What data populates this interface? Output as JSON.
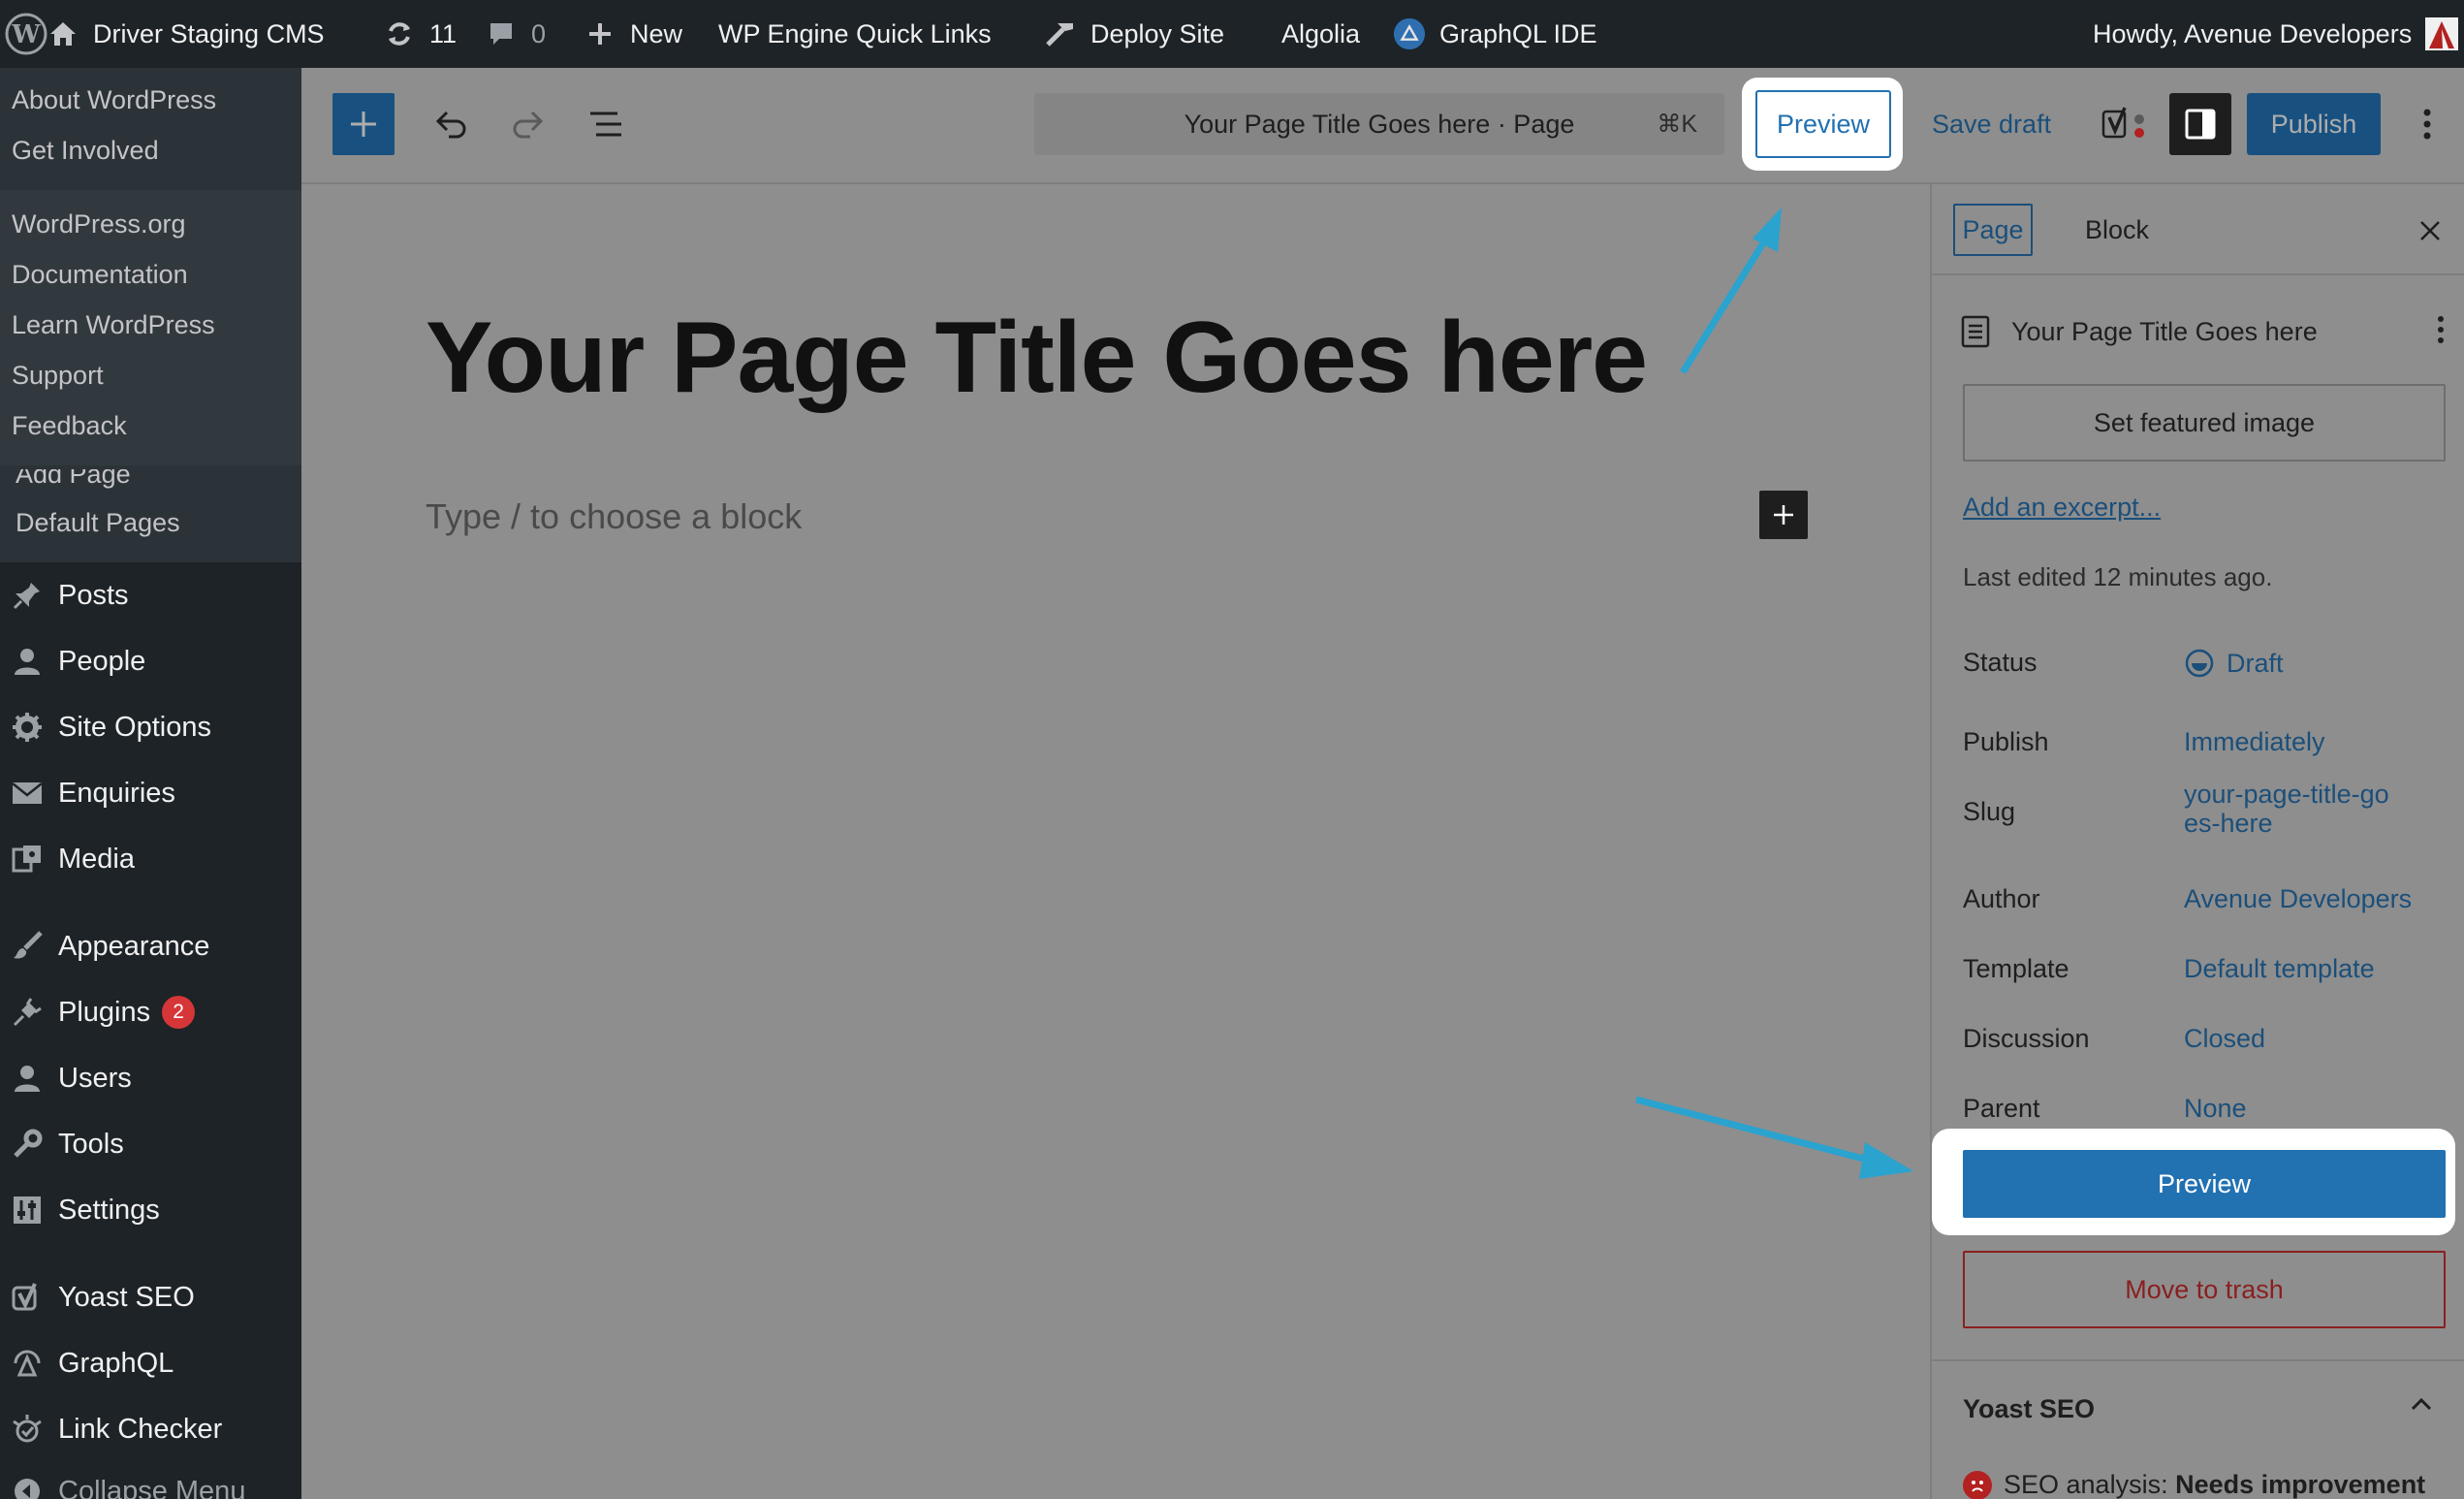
{
  "adminbar": {
    "site_name": "Driver Staging CMS",
    "updates_count": "11",
    "comments_count": "0",
    "new_label": "New",
    "wpengine_label": "WP Engine Quick Links",
    "deploy_label": "Deploy Site",
    "algolia_label": "Algolia",
    "graphql_ide_label": "GraphQL IDE",
    "howdy": "Howdy, Avenue Developers"
  },
  "wp_flyout": {
    "about": "About WordPress",
    "get_involved": "Get Involved",
    "wordpress_org": "WordPress.org",
    "documentation": "Documentation",
    "learn": "Learn WordPress",
    "support": "Support",
    "feedback": "Feedback"
  },
  "submenu": {
    "add_page": "Add Page",
    "default_pages": "Default Pages"
  },
  "menu": {
    "posts": "Posts",
    "people": "People",
    "site_options": "Site Options",
    "enquiries": "Enquiries",
    "media": "Media",
    "appearance": "Appearance",
    "plugins": "Plugins",
    "plugins_badge": "2",
    "users": "Users",
    "tools": "Tools",
    "settings": "Settings",
    "yoast": "Yoast SEO",
    "graphql": "GraphQL",
    "link_checker": "Link Checker",
    "collapse": "Collapse Menu"
  },
  "toolbar": {
    "command_center_title": "Your Page Title Goes here · Page",
    "command_shortcut": "⌘K",
    "preview_label": "Preview",
    "save_draft_label": "Save draft",
    "publish_label": "Publish"
  },
  "canvas": {
    "page_title": "Your Page Title Goes here",
    "block_placeholder": "Type / to choose a block"
  },
  "sidebar": {
    "tab_page": "Page",
    "tab_block": "Block",
    "doc_title": "Your Page Title Goes here",
    "featured_image": "Set featured image",
    "add_excerpt": "Add an excerpt...",
    "last_edited": "Last edited 12 minutes ago.",
    "rows": {
      "status": {
        "label": "Status",
        "value": "Draft"
      },
      "publish": {
        "label": "Publish",
        "value": "Immediately"
      },
      "slug": {
        "label": "Slug",
        "value": "your-page-title-goes-here"
      },
      "author": {
        "label": "Author",
        "value": "Avenue Developers"
      },
      "template": {
        "label": "Template",
        "value": "Default template"
      },
      "discussion": {
        "label": "Discussion",
        "value": "Closed"
      },
      "parent": {
        "label": "Parent",
        "value": "None"
      }
    },
    "preview_label": "Preview",
    "trash_label": "Move to trash",
    "yoast_title": "Yoast SEO",
    "seo_prefix": "SEO analysis:",
    "seo_result": "Needs improvement"
  },
  "colors": {
    "wp_blue": "#2271b1",
    "admin_dark": "#1d2327",
    "annotation_arrow": "#2aa3cf",
    "trash_red": "#8a1f1f"
  }
}
